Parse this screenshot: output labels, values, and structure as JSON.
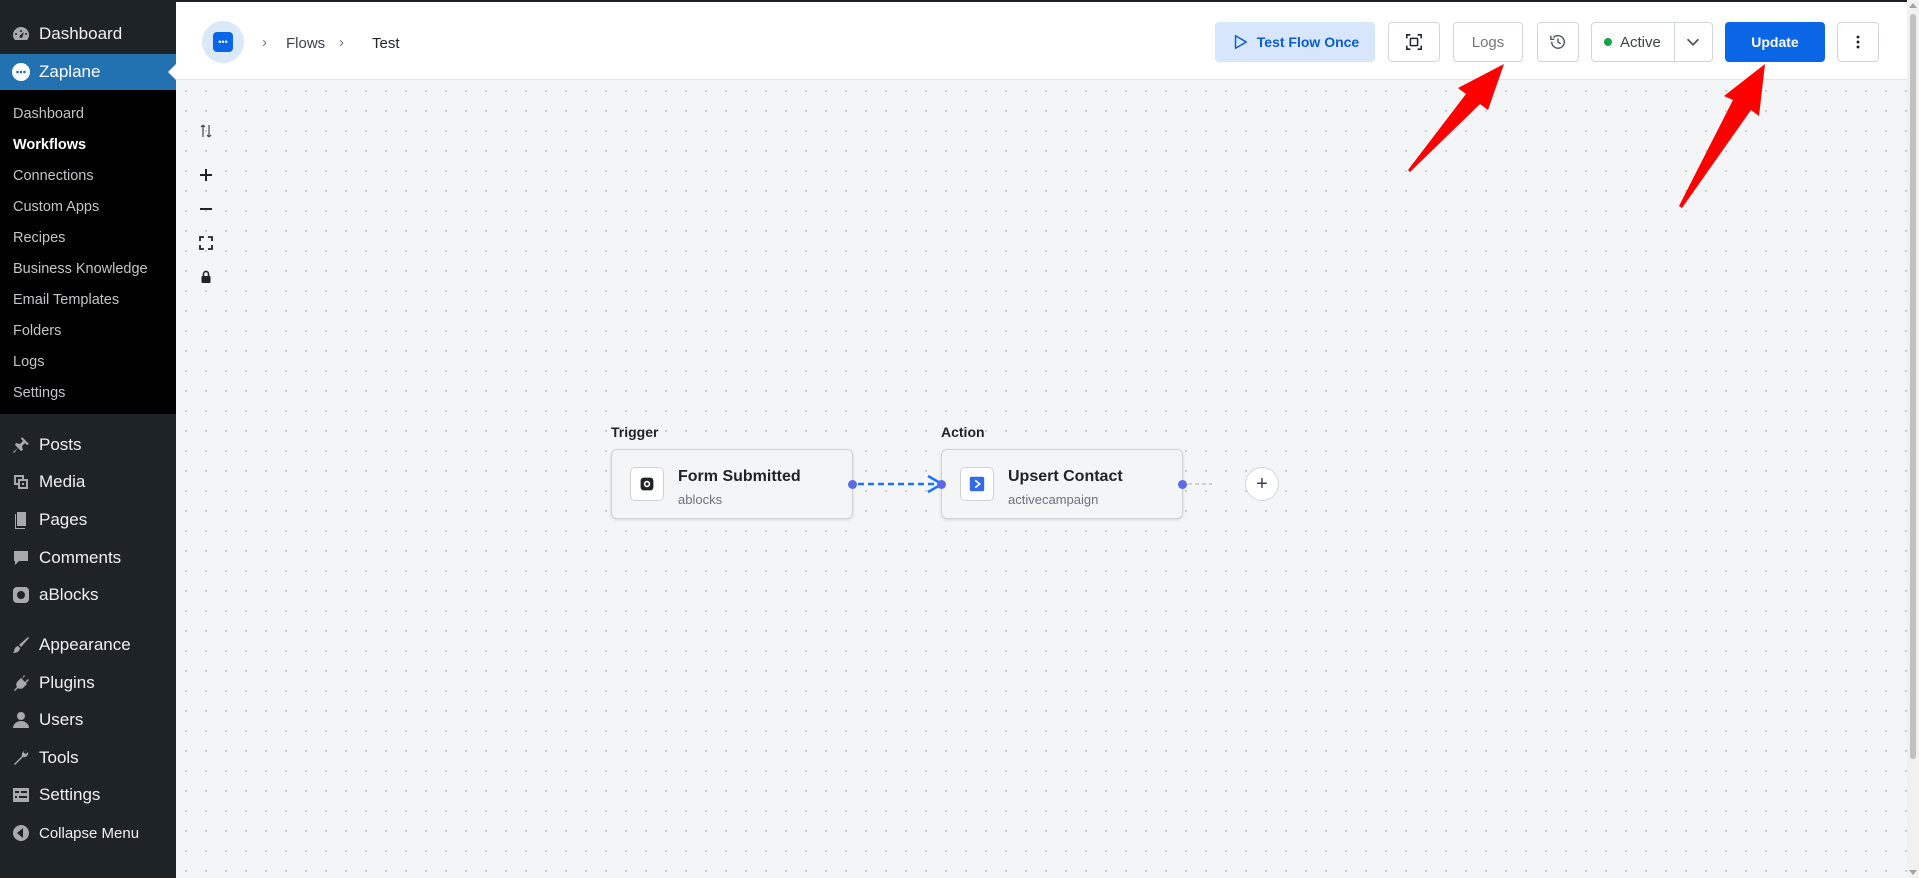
{
  "colors": {
    "accent": "#0a66e5",
    "status_active": "#16a34a",
    "annotation": "#ff0000",
    "wp_sidebar": "#1d2327",
    "wp_current": "#2271b1"
  },
  "wp_menu": {
    "dashboard": {
      "label": "Dashboard",
      "icon": "dashboard-icon"
    },
    "zaplane": {
      "label": "Zaplane",
      "icon": "zaplane-logo-icon"
    },
    "submenu": [
      "Dashboard",
      "Workflows",
      "Connections",
      "Custom Apps",
      "Recipes",
      "Business Knowledge",
      "Email Templates",
      "Folders",
      "Logs",
      "Settings"
    ],
    "submenu_current": "Workflows",
    "items": [
      {
        "label": "Posts",
        "icon": "pushpin-icon"
      },
      {
        "label": "Media",
        "icon": "media-icon"
      },
      {
        "label": "Pages",
        "icon": "pages-icon"
      },
      {
        "label": "Comments",
        "icon": "comment-icon"
      },
      {
        "label": "aBlocks",
        "icon": "ablocks-icon"
      },
      {
        "label": "Appearance",
        "icon": "brush-icon"
      },
      {
        "label": "Plugins",
        "icon": "plug-icon"
      },
      {
        "label": "Users",
        "icon": "user-icon"
      },
      {
        "label": "Tools",
        "icon": "wrench-icon"
      },
      {
        "label": "Settings",
        "icon": "settings-icon"
      },
      {
        "label": "Collapse Menu",
        "icon": "collapse-icon"
      }
    ]
  },
  "breadcrumb": {
    "flows": "Flows",
    "current": "Test"
  },
  "toolbar": {
    "test_flow_label": "Test Flow Once",
    "logs_label": "Logs",
    "status_label": "Active",
    "update_label": "Update"
  },
  "flow": {
    "trigger": {
      "section": "Trigger",
      "title": "Form Submitted",
      "app": "ablocks"
    },
    "action": {
      "section": "Action",
      "title": "Upsert Contact",
      "app": "activecampaign"
    }
  }
}
